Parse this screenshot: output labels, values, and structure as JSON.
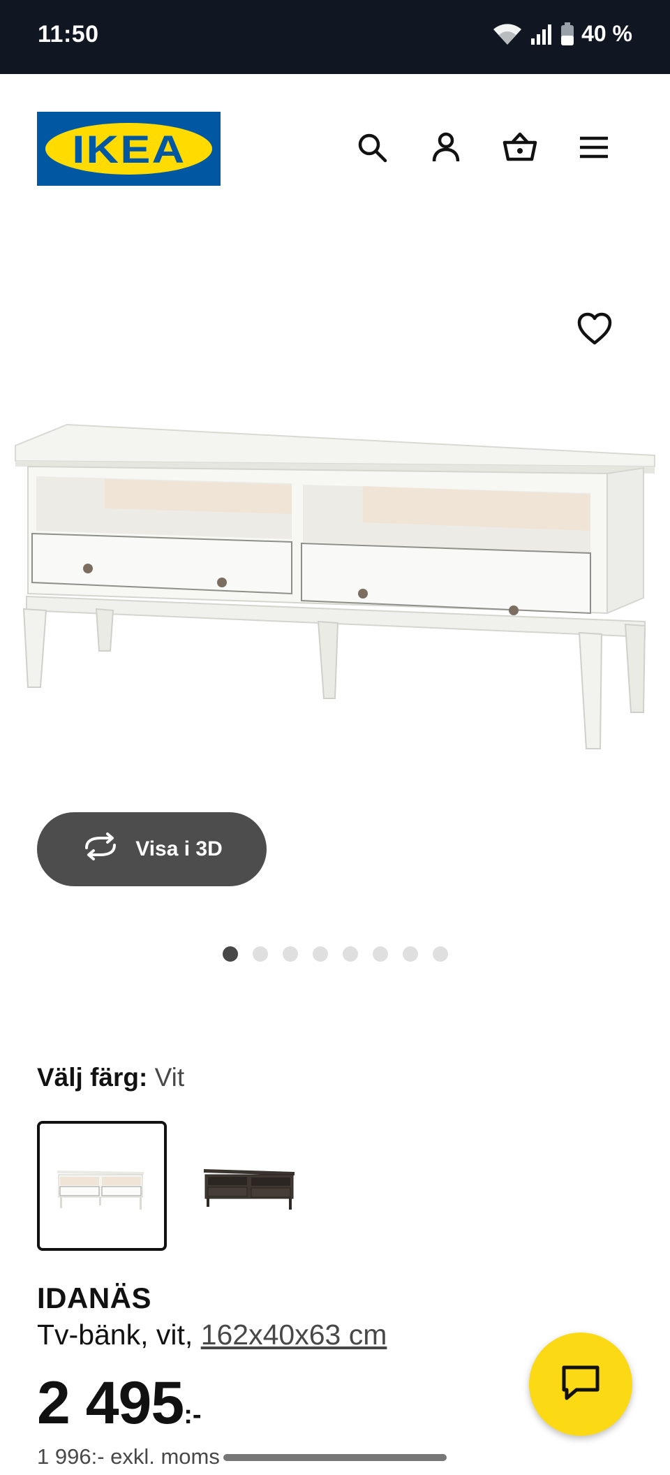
{
  "status_bar": {
    "time": "11:50",
    "battery": "40 %"
  },
  "header": {
    "logo_text": "IKEA",
    "icons": [
      "search-icon",
      "user-icon",
      "shopping-bag-icon",
      "menu-icon"
    ]
  },
  "gallery": {
    "view3d_label": "Visa i 3D",
    "dots_total": 8,
    "active_dot": 1
  },
  "product": {
    "color_label": "Välj färg:",
    "color_value": "Vit",
    "swatches": [
      "Vit",
      "Svartbrun"
    ],
    "name": "IDANÄS",
    "description": "Tv-bänk, vit,",
    "dimensions": "162x40x63 cm",
    "price": "2 495",
    "price_suffix": ":-",
    "price_excl": "1 996:- exkl. moms"
  },
  "colors": {
    "accent_yellow": "#fbd914",
    "ikea_blue": "#0058a3",
    "status_bar_bg": "#111722",
    "button_gray": "#4d4d4d"
  }
}
